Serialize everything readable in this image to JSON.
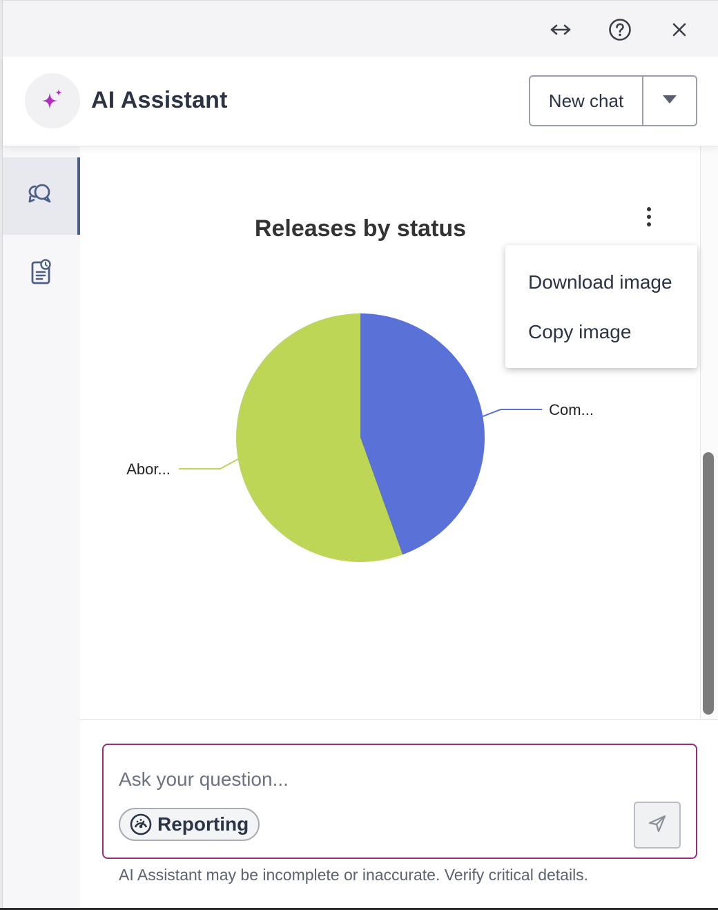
{
  "window": {
    "controls": [
      "expand-icon",
      "help-icon",
      "close-icon"
    ]
  },
  "header": {
    "title": "AI Assistant",
    "new_chat_label": "New chat",
    "avatar_icon": "sparkle-icon",
    "accent_color": "#b12cc0"
  },
  "sidebar": {
    "items": [
      {
        "icon": "chat-bubbles-icon",
        "active": true
      },
      {
        "icon": "report-history-icon",
        "active": false
      }
    ]
  },
  "chart_menu": {
    "items": [
      "Download image",
      "Copy image"
    ]
  },
  "chart_data": {
    "type": "pie",
    "title": "Releases by status",
    "slices": [
      {
        "label": "Com...",
        "value": 44.5,
        "color": "#5a72d8"
      },
      {
        "label": "Abor...",
        "value": 55.5,
        "color": "#bed656"
      }
    ],
    "legend": "none"
  },
  "composer": {
    "placeholder": "Ask your question...",
    "chip_label": "Reporting",
    "chip_icon": "gauge-icon",
    "send_icon": "send-icon",
    "border_color": "#9c2a78"
  },
  "disclaimer": "AI Assistant may be incomplete or inaccurate. Verify critical details."
}
